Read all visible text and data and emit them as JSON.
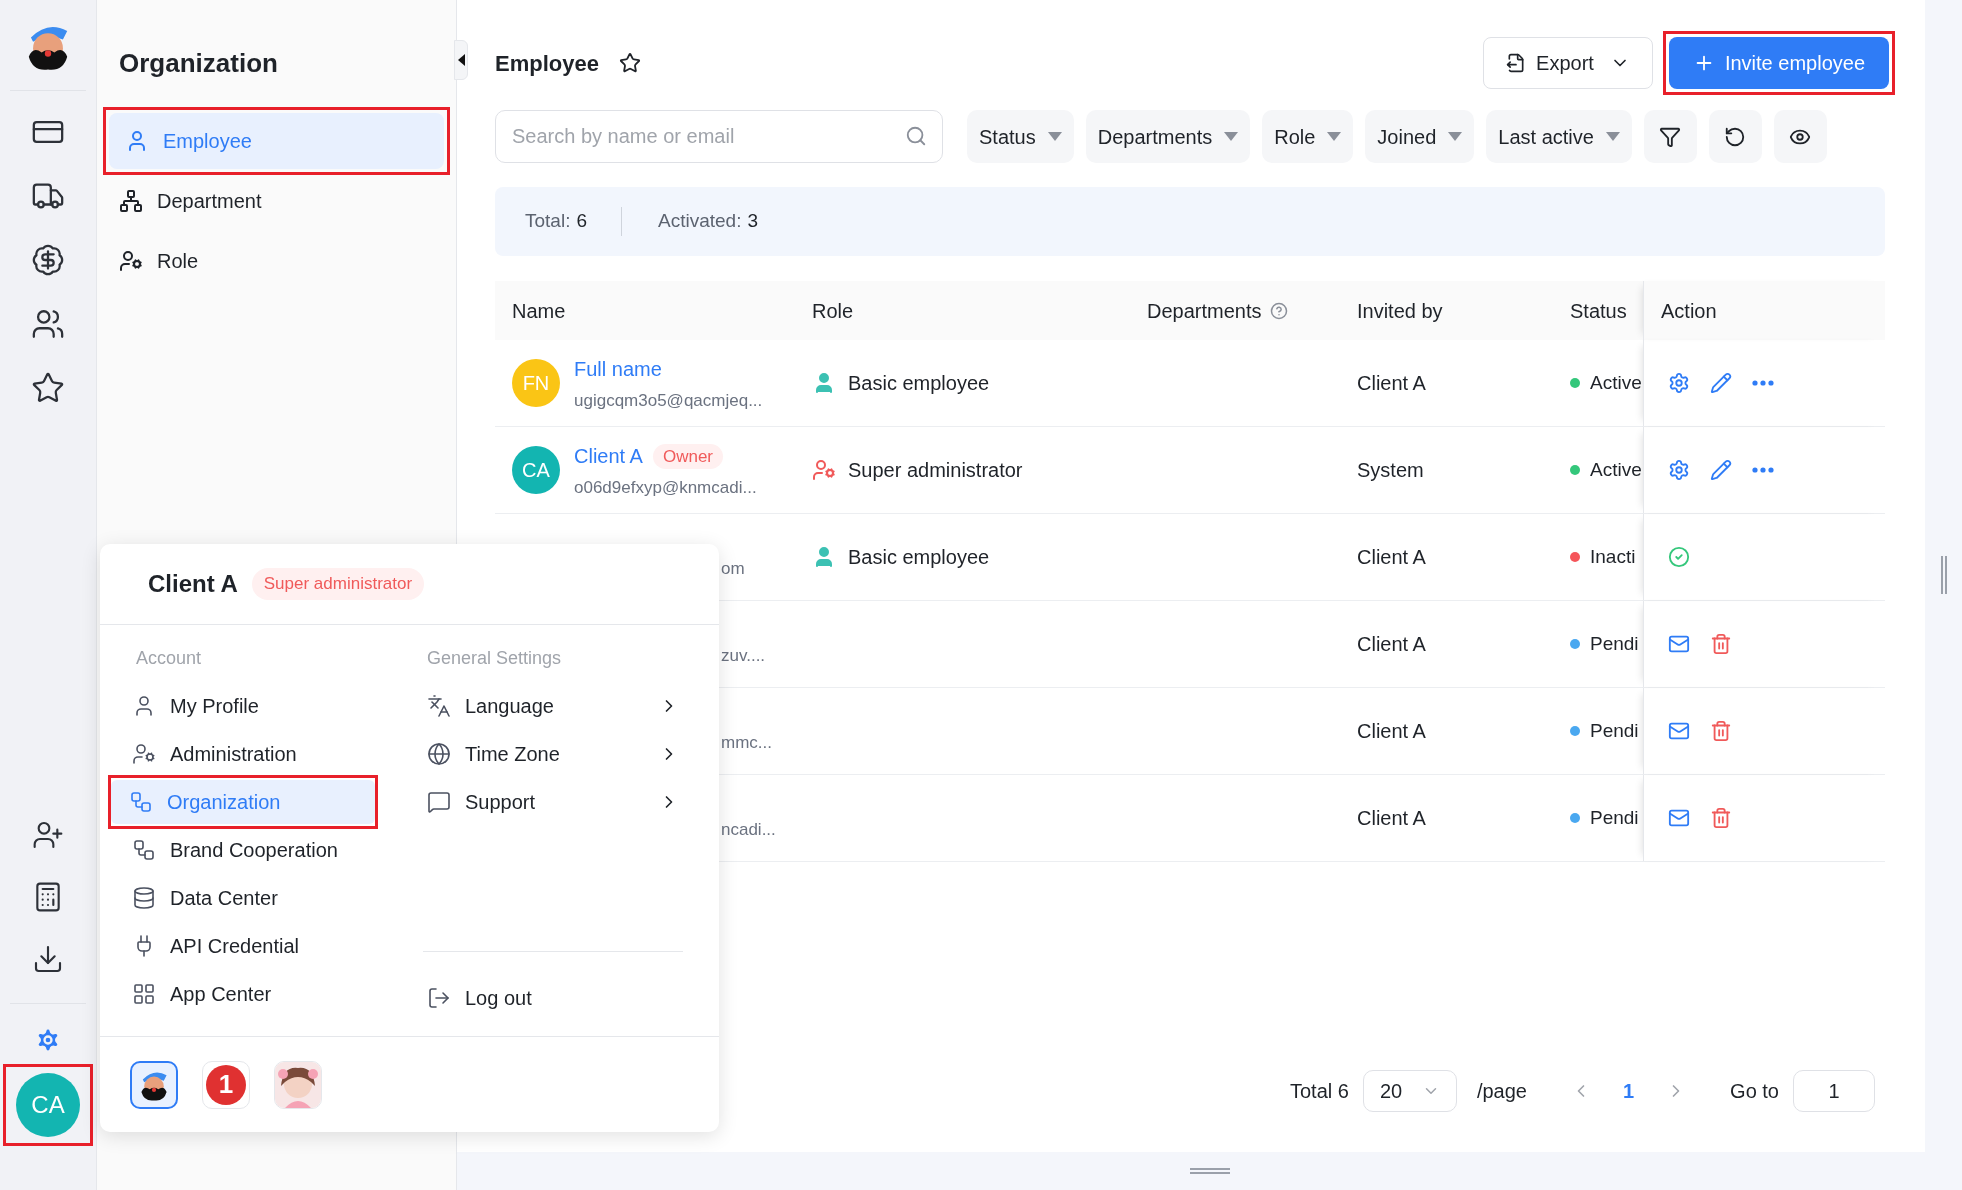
{
  "rail": {
    "avatar": {
      "text": "CA",
      "highlighted": true
    }
  },
  "sidebar": {
    "title": "Organization",
    "items": [
      {
        "label": "Employee",
        "selected": true,
        "highlighted": true
      },
      {
        "label": "Department",
        "selected": false,
        "highlighted": false
      },
      {
        "label": "Role",
        "selected": false,
        "highlighted": false
      }
    ]
  },
  "header": {
    "title": "Employee",
    "export": "Export",
    "invite": {
      "label": "Invite employee",
      "highlighted": true
    }
  },
  "search": {
    "placeholder": "Search by name or email"
  },
  "filters": [
    "Status",
    "Departments",
    "Role",
    "Joined",
    "Last active"
  ],
  "summary": [
    {
      "label": "Total:",
      "value": "6"
    },
    {
      "label": "Activated:",
      "value": "3"
    }
  ],
  "table": {
    "columns": [
      {
        "label": "Name",
        "help": false
      },
      {
        "label": "Role",
        "help": false
      },
      {
        "label": "Departments",
        "help": true
      },
      {
        "label": "Invited by",
        "help": false
      },
      {
        "label": "Status",
        "help": false
      },
      {
        "label": "Action",
        "help": false
      }
    ],
    "rows": [
      {
        "kind": "manage",
        "avatar": {
          "text": "FN",
          "color": "#fac515"
        },
        "name": "Full name",
        "tag": null,
        "email": "ugigcqm3o5@qacmjeq...",
        "role": {
          "label": "Basic employee",
          "kind": "basic"
        },
        "invited_by": "Client A",
        "status": {
          "text": "Active",
          "color": "#34c77b"
        }
      },
      {
        "kind": "manage",
        "avatar": {
          "text": "CA",
          "color": "#13b5b1"
        },
        "name": "Client A",
        "tag": "Owner",
        "email": "o06d9efxyp@knmcadi...",
        "role": {
          "label": "Super administrator",
          "kind": "admin"
        },
        "invited_by": "System",
        "status": {
          "text": "Active",
          "color": "#34c77b"
        }
      },
      {
        "kind": "activate",
        "email": "om",
        "role": {
          "label": "Basic employee",
          "kind": "basic"
        },
        "invited_by": "Client A",
        "status": {
          "text": "Inacti",
          "color": "#f5555a"
        }
      },
      {
        "kind": "pending",
        "email": "zuv....",
        "invited_by": "Client A",
        "status": {
          "text": "Pendi",
          "color": "#4aa8f0"
        }
      },
      {
        "kind": "pending",
        "email": "mmc...",
        "invited_by": "Client A",
        "status": {
          "text": "Pendi",
          "color": "#4aa8f0"
        }
      },
      {
        "kind": "pending",
        "email": "ncadi...",
        "invited_by": "Client A",
        "status": {
          "text": "Pendi",
          "color": "#4aa8f0"
        }
      }
    ]
  },
  "pagination": {
    "total": "Total 6",
    "page_size": "20",
    "per_page": "/page",
    "pages": [
      {
        "label": "1",
        "selected": true
      }
    ],
    "goto_label": "Go to",
    "goto_value": "1"
  },
  "popup": {
    "user": "Client A",
    "role_tag": "Super administrator",
    "account_heading": "Account",
    "account_items": [
      {
        "label": "My Profile",
        "selected": false,
        "highlighted": false
      },
      {
        "label": "Administration",
        "selected": false,
        "highlighted": false
      },
      {
        "label": "Organization",
        "selected": true,
        "highlighted": true
      },
      {
        "label": "Brand Cooperation",
        "selected": false,
        "highlighted": false
      },
      {
        "label": "Data Center",
        "selected": false,
        "highlighted": false
      },
      {
        "label": "API Credential",
        "selected": false,
        "highlighted": false
      },
      {
        "label": "App Center",
        "selected": false,
        "highlighted": false
      }
    ],
    "settings_heading": "General Settings",
    "settings_items": [
      {
        "label": "Language",
        "submenu": true
      },
      {
        "label": "Time Zone",
        "submenu": true
      },
      {
        "label": "Support",
        "submenu": true
      }
    ],
    "logout": "Log out",
    "apps": [
      {
        "kind": "mascot",
        "selected": true
      },
      {
        "kind": "number",
        "text": "1",
        "selected": false
      },
      {
        "kind": "picture",
        "selected": false
      }
    ]
  }
}
